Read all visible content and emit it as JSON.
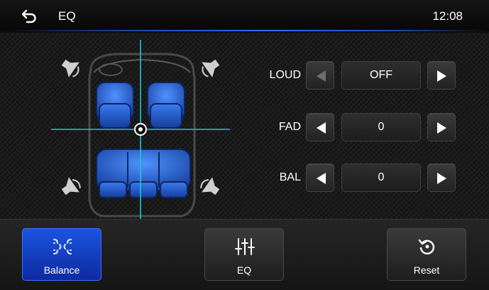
{
  "header": {
    "title": "EQ",
    "time": "12:08",
    "back_icon": "back-arrow-icon"
  },
  "balance_view": {
    "crosshair_color": "#19c8d6",
    "seat_color": "#1c56c4"
  },
  "controls": [
    {
      "id": "loud",
      "label": "LOUD",
      "value": "OFF",
      "left_enabled": false,
      "right_enabled": true
    },
    {
      "id": "fad",
      "label": "FAD",
      "value": "0",
      "left_enabled": true,
      "right_enabled": true
    },
    {
      "id": "bal",
      "label": "BAL",
      "value": "0",
      "left_enabled": true,
      "right_enabled": true
    }
  ],
  "tabs": [
    {
      "label": "Balance",
      "icon": "balance-icon",
      "active": true
    },
    {
      "label": "EQ",
      "icon": "eq-sliders-icon",
      "active": false
    },
    {
      "label": "Reset",
      "icon": "reset-icon",
      "active": false
    }
  ],
  "colors": {
    "accent": "#1a55e0",
    "header_glow": "#2f6bff"
  }
}
